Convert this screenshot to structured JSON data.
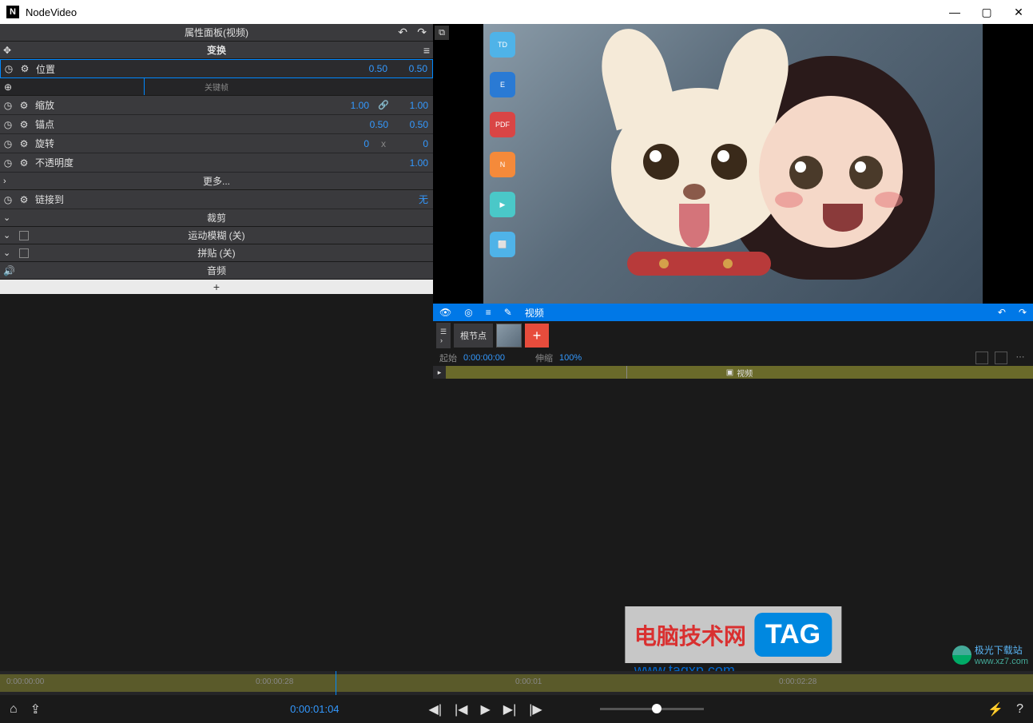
{
  "app": {
    "title": "NodeVideo",
    "logo": "N"
  },
  "window_controls": {
    "min": "—",
    "max": "▢",
    "close": "✕"
  },
  "properties": {
    "panel_title": "属性面板(视频)",
    "transform_section": "变换",
    "position": {
      "label": "位置",
      "x": "0.50",
      "y": "0.50"
    },
    "keyframe_label": "关键帧",
    "scale": {
      "label": "缩放",
      "x": "1.00",
      "y": "1.00"
    },
    "anchor": {
      "label": "锚点",
      "x": "0.50",
      "y": "0.50"
    },
    "rotation": {
      "label": "旋转",
      "val": "0",
      "axis": "x",
      "val2": "0"
    },
    "opacity": {
      "label": "不透明度",
      "val": "1.00"
    },
    "more": "更多...",
    "link_to": {
      "label": "链接到",
      "val": "无"
    },
    "crop": "裁剪",
    "motion_blur": "运动模糊 (关)",
    "tile": "拼贴 (关)",
    "audio": "音频",
    "add": "+"
  },
  "node_toolbar": {
    "video_label": "视频"
  },
  "node_strip": {
    "root_label": "根节点"
  },
  "info": {
    "start_label": "起始",
    "start_val": "0:00:00:00",
    "stretch_label": "伸缩",
    "stretch_val": "100%"
  },
  "track": {
    "clip_label": "视频"
  },
  "timeline": {
    "t0": "0:00:00:00",
    "t1": "0:00:00:28",
    "t2": "0:00:01",
    "t3": "0:00:02:28"
  },
  "player": {
    "current_time": "0:00:01:04"
  },
  "watermark": {
    "cn": "电脑技术网",
    "url": "www.tagxp.com",
    "tag": "TAG",
    "site2a": "极光下载站",
    "site2b": "www.xz7.com"
  },
  "desktop": {
    "icons": [
      {
        "bg": "#4fb3e8",
        "t": "TD"
      },
      {
        "bg": "#2a7ad4",
        "t": "E"
      },
      {
        "bg": "#d94545",
        "t": "PDF"
      },
      {
        "bg": "#f58a3a",
        "t": "N"
      },
      {
        "bg": "#4ac8c8",
        "t": "▶"
      },
      {
        "bg": "#4fb3e8",
        "t": "⬜"
      }
    ]
  }
}
